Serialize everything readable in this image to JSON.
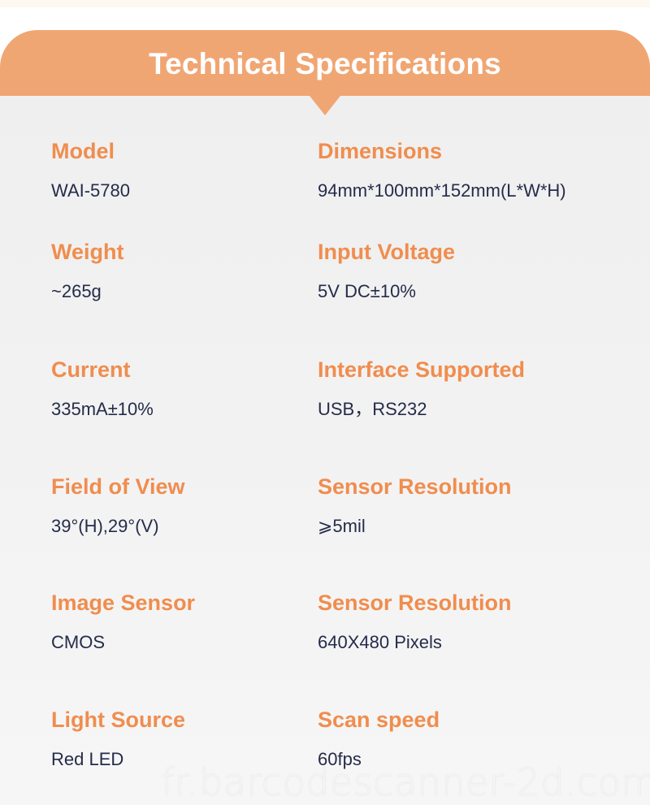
{
  "header": {
    "title": "Technical Specifications"
  },
  "colors": {
    "banner": "#f0a673",
    "label": "#f08d4e",
    "value": "#252c4a",
    "panel_background": "#efefef"
  },
  "specs": [
    {
      "label": "Model",
      "value": "WAI-5780"
    },
    {
      "label": "Dimensions",
      "value": "94mm*100mm*152mm(L*W*H)"
    },
    {
      "label": "Weight",
      "value": "~265g"
    },
    {
      "label": "Input Voltage",
      "value": "5V DC±10%"
    },
    {
      "label": "Current",
      "value": "335mA±10%"
    },
    {
      "label": "Interface Supported",
      "value": "USB，RS232"
    },
    {
      "label": "Field of View",
      "value": "39°(H),29°(V)"
    },
    {
      "label": "Sensor Resolution",
      "value": "⩾5mil"
    },
    {
      "label": "Image Sensor",
      "value": "CMOS"
    },
    {
      "label": "Sensor Resolution",
      "value": "640X480 Pixels"
    },
    {
      "label": "Light Source",
      "value": "Red LED"
    },
    {
      "label": "Scan speed",
      "value": "60fps"
    }
  ],
  "watermark": "fr.barcodescanner-2d.com"
}
